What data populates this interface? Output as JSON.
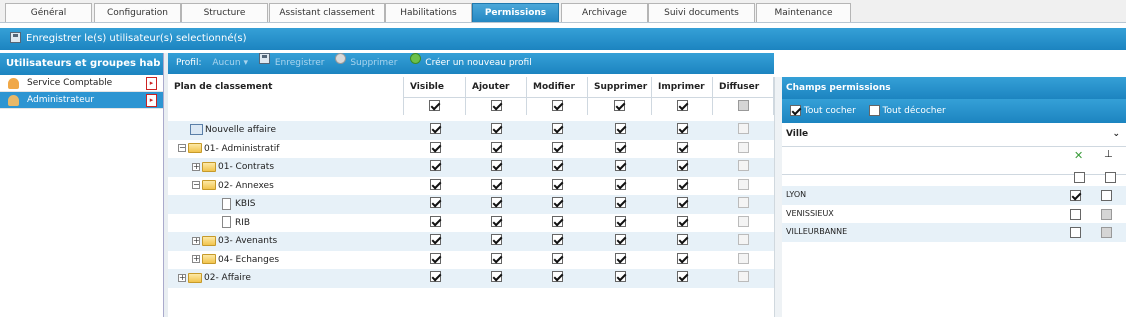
{
  "tabs": [
    {
      "label": "Général",
      "active": false
    },
    {
      "label": "Configuration",
      "active": false
    },
    {
      "label": "Structure",
      "active": false
    },
    {
      "label": "Assistant classement",
      "active": false
    },
    {
      "label": "Habilitations",
      "active": false
    },
    {
      "label": "Permissions",
      "active": true
    },
    {
      "label": "Archivage",
      "active": false
    },
    {
      "label": "Suivi documents",
      "active": false
    },
    {
      "label": "Maintenance",
      "active": false
    }
  ],
  "toolbar": {
    "save_users_label": "Enregistrer le(s) utilisateur(s) selectionné(s)"
  },
  "users_panel": {
    "title": "Utilisateurs et groupes hab",
    "items": [
      {
        "label": "Service Comptable",
        "icon": "group-icon",
        "selected": false
      },
      {
        "label": "Administrateur",
        "icon": "user-icon",
        "selected": true
      }
    ]
  },
  "profile_bar": {
    "profil_label": "Profil:",
    "profil_value": "Aucun",
    "save_label": "Enregistrer",
    "delete_label": "Supprimer",
    "new_profile_label": "Créer un nouveau profil"
  },
  "grid": {
    "tree_header": "Plan de classement",
    "columns": [
      "Visible",
      "Ajouter",
      "Modifier",
      "Supprimer",
      "Imprimer",
      "Diffuser"
    ],
    "header_checks": [
      true,
      true,
      true,
      true,
      true,
      false
    ],
    "rows": [
      {
        "label": "Nouvelle affaire",
        "type": "node",
        "expander": "",
        "level": 0,
        "checks": [
          true,
          true,
          true,
          true,
          true,
          false
        ]
      },
      {
        "label": "01- Administratif",
        "type": "folder",
        "expander": "−",
        "level": 0,
        "checks": [
          true,
          true,
          true,
          true,
          true,
          false
        ]
      },
      {
        "label": "01- Contrats",
        "type": "folder",
        "expander": "+",
        "level": 1,
        "checks": [
          true,
          true,
          true,
          true,
          true,
          false
        ]
      },
      {
        "label": "02- Annexes",
        "type": "folder",
        "expander": "−",
        "level": 1,
        "checks": [
          true,
          true,
          true,
          true,
          true,
          false
        ]
      },
      {
        "label": "KBIS",
        "type": "doc",
        "expander": "",
        "level": 2,
        "checks": [
          true,
          true,
          true,
          true,
          true,
          false
        ]
      },
      {
        "label": "RIB",
        "type": "doc",
        "expander": "",
        "level": 2,
        "checks": [
          true,
          true,
          true,
          true,
          true,
          false
        ]
      },
      {
        "label": "03- Avenants",
        "type": "folder",
        "expander": "+",
        "level": 1,
        "checks": [
          true,
          true,
          true,
          true,
          true,
          false
        ]
      },
      {
        "label": "04- Echanges",
        "type": "folder",
        "expander": "+",
        "level": 1,
        "checks": [
          true,
          true,
          true,
          true,
          true,
          false
        ]
      },
      {
        "label": "02- Affaire",
        "type": "folder",
        "expander": "+",
        "level": 0,
        "checks": [
          true,
          true,
          true,
          true,
          true,
          false
        ]
      }
    ]
  },
  "fields_panel": {
    "title": "Champs permissions",
    "check_all_label": "Tout cocher",
    "uncheck_all_label": "Tout décocher",
    "field_name": "Ville",
    "col1_icon": "tools-cross-icon",
    "col2_icon": "hierarchy-icon",
    "values": [
      {
        "label": "LYON",
        "c1": true,
        "c2": false
      },
      {
        "label": "VENISSIEUX",
        "c1": false,
        "c2": "grey"
      },
      {
        "label": "VILLEURBANNE",
        "c1": false,
        "c2": "grey"
      }
    ]
  },
  "colors": {
    "accent": "#2487c2",
    "selected": "#2d95d2",
    "row_alt": "#e7f1f8"
  }
}
